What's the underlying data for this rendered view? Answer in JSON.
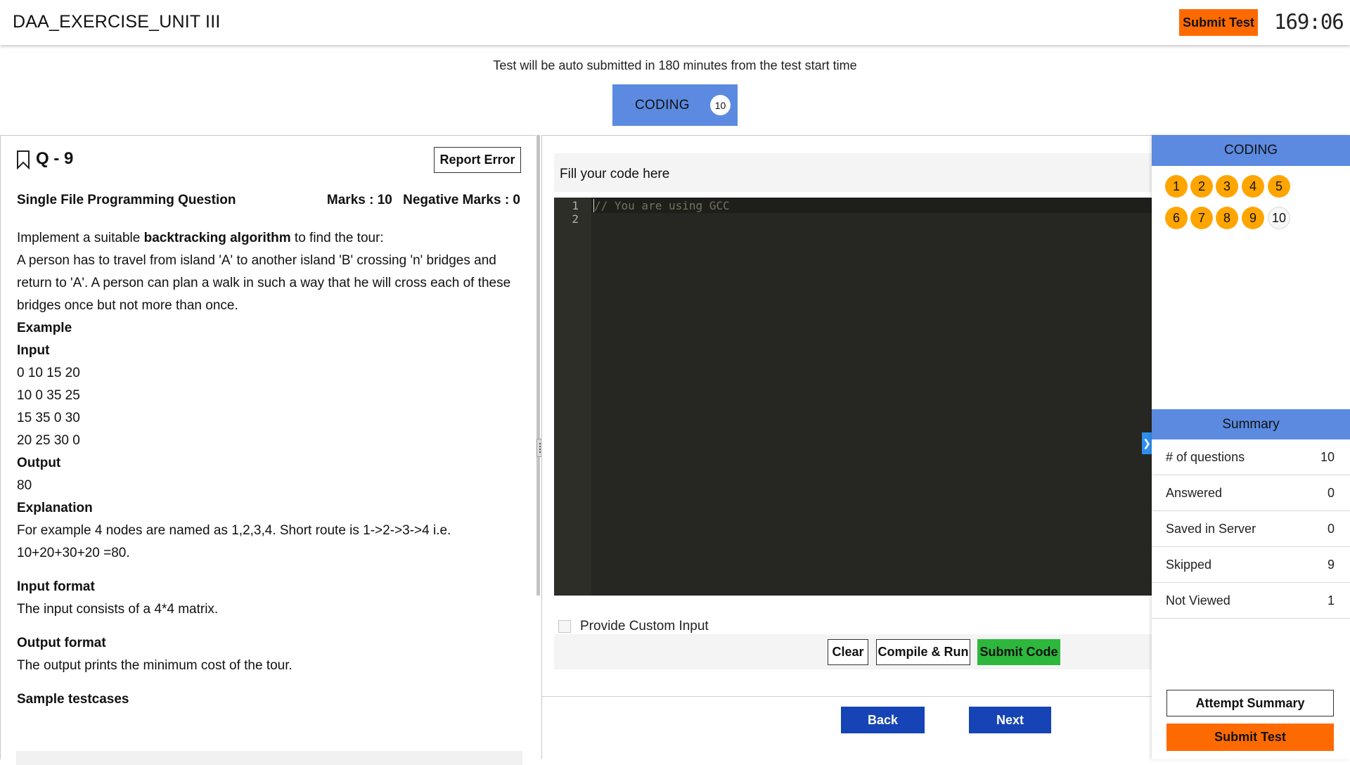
{
  "header": {
    "title": "DAA_EXERCISE_UNIT III",
    "submit_label": "Submit Test",
    "timer": "169:06"
  },
  "notice": "Test will be auto submitted in 180 minutes from the test start time",
  "section": {
    "label": "CODING",
    "count": "10"
  },
  "question": {
    "number": "Q - 9",
    "report_label": "Report Error",
    "type": "Single File Programming Question",
    "marks": "Marks : 10",
    "negative_marks": "Negative Marks : 0",
    "intro_prefix": "Implement a suitable ",
    "intro_bold": "backtracking algorithm",
    "intro_suffix": " to find the tour:",
    "description": "A person has to travel from island 'A' to another island 'B' crossing 'n' bridges and return to 'A'. A person can plan a walk in such a way that he will cross each of these bridges once but not more than once.",
    "example_heading": "Example",
    "input_heading": "Input",
    "input_lines": [
      "0 10 15 20",
      "10 0 35 25",
      "15 35 0 30",
      "20 25 30 0"
    ],
    "output_heading": "Output",
    "output_value": "80",
    "explanation_heading": "Explanation",
    "explanation": "For example 4 nodes are named as 1,2,3,4. Short route is 1->2->3->4 i.e. 10+20+30+20 =80.",
    "input_format_heading": "Input format",
    "input_format": "The input consists of a 4*4 matrix.",
    "output_format_heading": "Output format",
    "output_format": "The output prints the minimum cost of the tour.",
    "sample_heading": "Sample testcases"
  },
  "editor": {
    "fill_label": "Fill your code here",
    "line_numbers": [
      "1",
      "2"
    ],
    "code_line_1": "// You are using GCC",
    "custom_input_label": "Provide Custom Input",
    "clear_label": "Clear",
    "compile_label": "Compile & Run",
    "submit_code_label": "Submit Code",
    "back_label": "Back",
    "next_label": "Next",
    "colors": {
      "background": "#262722",
      "comment": "#75715e"
    }
  },
  "navigator": {
    "heading": "CODING",
    "questions": [
      {
        "n": "1",
        "status": "skipped"
      },
      {
        "n": "2",
        "status": "skipped"
      },
      {
        "n": "3",
        "status": "skipped"
      },
      {
        "n": "4",
        "status": "skipped"
      },
      {
        "n": "5",
        "status": "skipped"
      },
      {
        "n": "6",
        "status": "skipped"
      },
      {
        "n": "7",
        "status": "skipped"
      },
      {
        "n": "8",
        "status": "skipped"
      },
      {
        "n": "9",
        "status": "skipped"
      },
      {
        "n": "10",
        "status": "not-viewed"
      }
    ]
  },
  "summary": {
    "heading": "Summary",
    "rows": [
      {
        "label": "# of questions",
        "value": "10"
      },
      {
        "label": "Answered",
        "value": "0"
      },
      {
        "label": "Saved in Server",
        "value": "0"
      },
      {
        "label": "Skipped",
        "value": "9"
      },
      {
        "label": "Not Viewed",
        "value": "1"
      }
    ],
    "attempt_label": "Attempt Summary",
    "submit_label": "Submit Test"
  },
  "colors": {
    "accent_blue": "#5b8ae0",
    "submit_orange": "#ff6a00",
    "skipped_orange": "#ffa500",
    "submit_code_green": "#2db83d",
    "nav_button_blue": "#1643b5"
  }
}
